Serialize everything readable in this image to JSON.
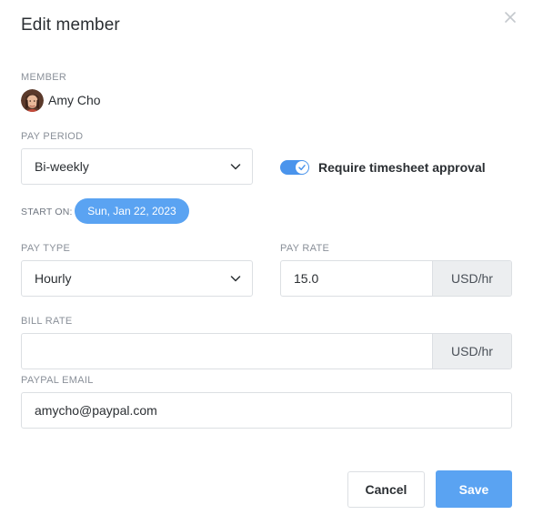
{
  "dialog": {
    "title": "Edit member"
  },
  "member": {
    "label": "MEMBER",
    "name": "Amy Cho"
  },
  "pay_period": {
    "label": "PAY PERIOD",
    "value": "Bi-weekly"
  },
  "timesheet_approval": {
    "label": "Require timesheet approval",
    "enabled": true
  },
  "start_on": {
    "label": "START ON:",
    "date": "Sun, Jan 22, 2023"
  },
  "pay_type": {
    "label": "PAY TYPE",
    "value": "Hourly"
  },
  "pay_rate": {
    "label": "PAY RATE",
    "value": "15.0",
    "unit": "USD/hr"
  },
  "bill_rate": {
    "label": "BILL RATE",
    "value": "",
    "unit": "USD/hr"
  },
  "paypal_email": {
    "label": "PAYPAL EMAIL",
    "value": "amycho@paypal.com"
  },
  "actions": {
    "cancel_label": "Cancel",
    "save_label": "Save"
  },
  "colors": {
    "accent": "#4a94ec",
    "pill": "#5aa3f2",
    "addon_bg": "#eceef0"
  },
  "icons": {
    "close": "close-icon",
    "chevron": "chevron-down-icon",
    "check": "check-icon"
  }
}
